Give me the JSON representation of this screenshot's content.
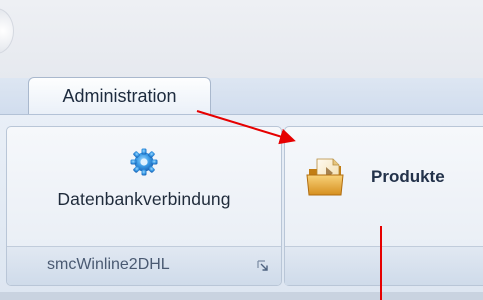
{
  "ribbon": {
    "tabs": [
      {
        "label": "Administration",
        "active": true
      }
    ],
    "groups": [
      {
        "label": "smcWinline2DHL",
        "buttons": [
          {
            "label": "Datenbankverbindung",
            "icon": "gear-icon"
          }
        ],
        "dialog_launcher_icon": "dialog-launcher-icon"
      },
      {
        "label": "",
        "buttons": [
          {
            "label": "Produkte",
            "icon": "folder-icon"
          }
        ]
      }
    ]
  },
  "annotations": {
    "color": "#e60000",
    "items": [
      "arrow",
      "line"
    ]
  }
}
